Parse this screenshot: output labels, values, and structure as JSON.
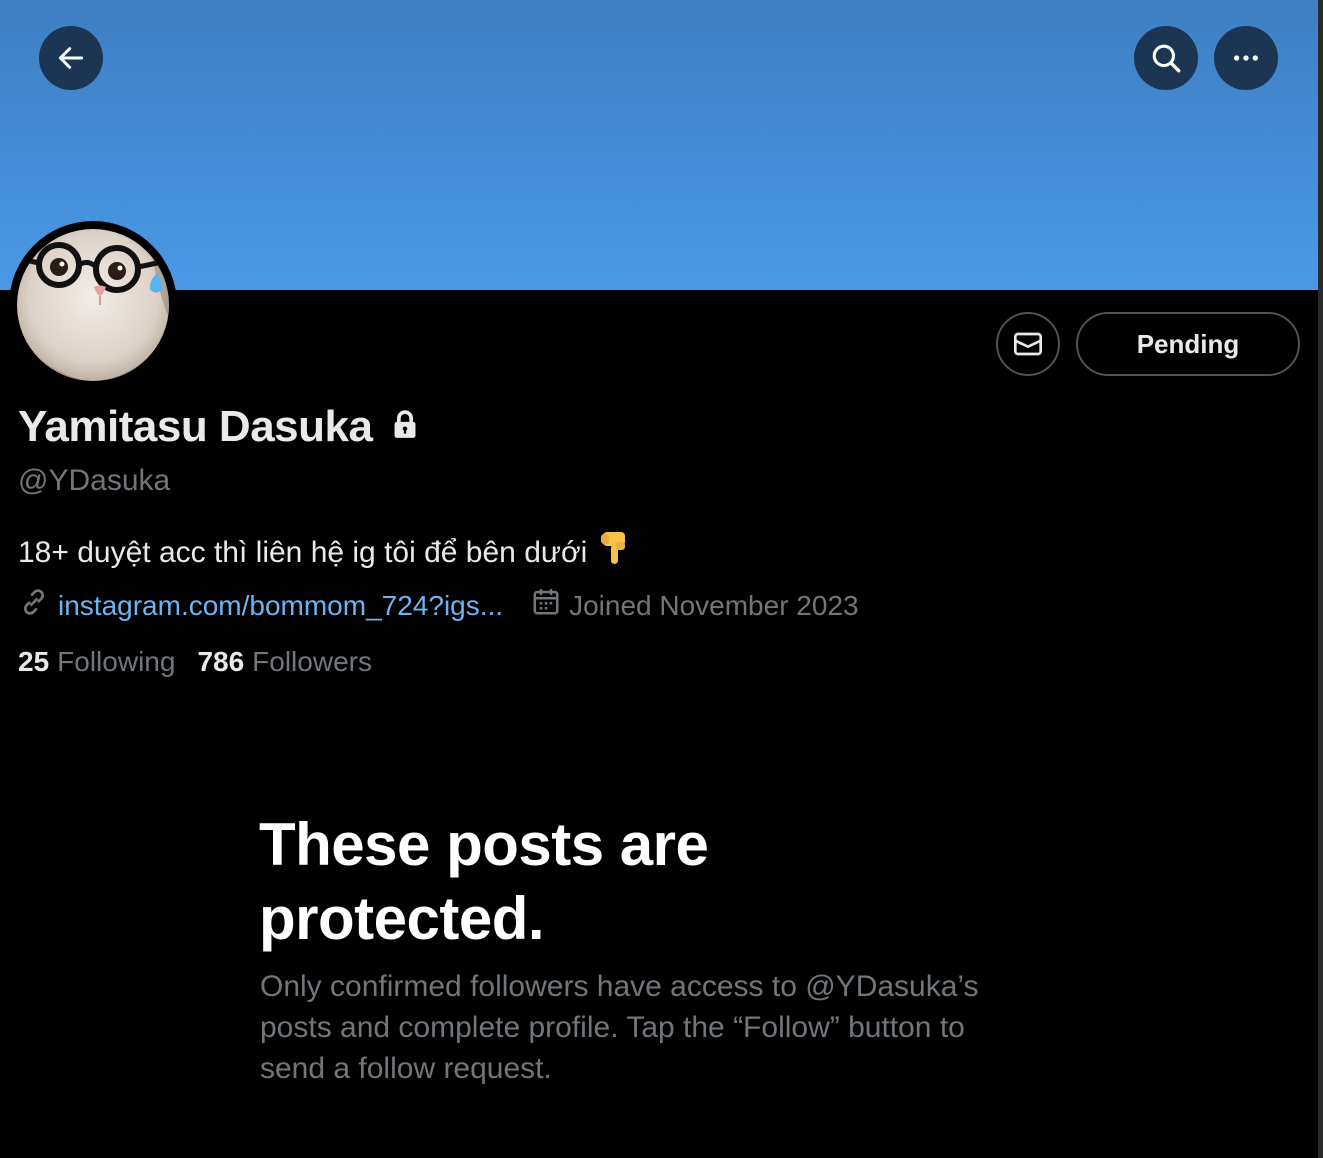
{
  "header": {
    "back_icon": "arrow-left-icon",
    "search_icon": "search-icon",
    "more_icon": "more-horizontal-icon",
    "banner_color": "#4a98e6"
  },
  "profile": {
    "display_name": "Yamitasu Dasuka",
    "lock_icon": "lock-icon",
    "handle": "@YDasuka",
    "bio": "18+ duyệt acc thì liên hệ ig tôi để bên dưới",
    "bio_emoji": "👇",
    "link_text": "instagram.com/bommom_724?igs...",
    "joined": "Joined November 2023"
  },
  "actions": {
    "message_icon": "mail-icon",
    "pending_label": "Pending"
  },
  "stats": {
    "following_count": "25",
    "following_label": "Following",
    "followers_count": "786",
    "followers_label": "Followers"
  },
  "protected": {
    "title": "These posts are protected.",
    "description": "Only confirmed followers have access to @YDasuka’s posts and complete profile. Tap the “Follow” button to send a follow request."
  },
  "colors": {
    "accent_link": "#6cb4f2",
    "muted_text": "#71767b",
    "background": "#000000"
  }
}
